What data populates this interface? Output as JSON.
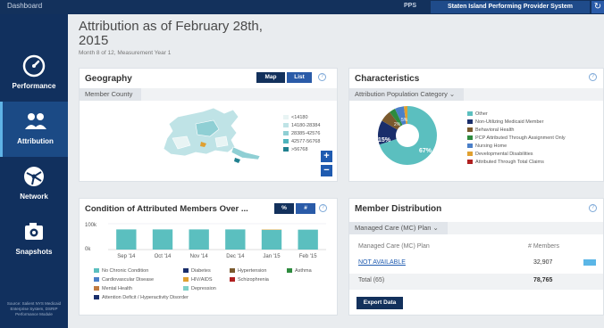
{
  "topbar": {
    "crumb": "Dashboard",
    "pps_label": "PPS",
    "pps_value": "Staten Island Performing Provider System"
  },
  "sidebar": {
    "items": [
      {
        "label": "Performance",
        "icon": "gauge-icon"
      },
      {
        "label": "Attribution",
        "icon": "people-icon"
      },
      {
        "label": "Network",
        "icon": "network-icon"
      },
      {
        "label": "Snapshots",
        "icon": "camera-icon"
      }
    ],
    "source": "Source: Salient NYS Medicaid Enterprise System, DSRIP Performance Module"
  },
  "header": {
    "title": "Attribution as of February 28th, 2015",
    "subtitle": "Month 8 of 12, Measurement Year 1"
  },
  "geography": {
    "title": "Geography",
    "map_btn": "Map",
    "list_btn": "List",
    "tab": "Member County",
    "legend": [
      "<14180",
      "14180-28384",
      "28385-42576",
      "42577-56768",
      ">56768"
    ],
    "legend_colors": [
      "#e8f4f4",
      "#bfe3e6",
      "#8fcfd4",
      "#4fb4bd",
      "#20808f"
    ],
    "zoom_in": "+",
    "zoom_out": "−"
  },
  "characteristics": {
    "title": "Characteristics",
    "tab": "Attribution Population Category",
    "legend": [
      {
        "label": "Other",
        "color": "#5bbfbf"
      },
      {
        "label": "Non-Utilizing Medicaid Member",
        "color": "#1a2e6b"
      },
      {
        "label": "Behavioral Health",
        "color": "#7a5a2e"
      },
      {
        "label": "PCP Attributed Through Assignment Only",
        "color": "#2e8b3e"
      },
      {
        "label": "Nursing Home",
        "color": "#4a7fc8"
      },
      {
        "label": "Developmental Disabilities",
        "color": "#e0a030"
      },
      {
        "label": "Attributed Through Total Claims",
        "color": "#b02020"
      }
    ],
    "pie_labels": [
      "67%",
      "15%",
      "2%",
      "5%"
    ]
  },
  "condition": {
    "title": "Condition of Attributed Members Over ...",
    "btn_a": "%",
    "btn_b": "#",
    "legend": [
      {
        "label": "No Chronic Condition",
        "color": "#5bbfbf"
      },
      {
        "label": "Diabetes",
        "color": "#1a2e6b"
      },
      {
        "label": "Hypertension",
        "color": "#7a5a2e"
      },
      {
        "label": "Asthma",
        "color": "#2e8b3e"
      },
      {
        "label": "Cardiovascular Disease",
        "color": "#4a7fc8"
      },
      {
        "label": "HIV/AIDS",
        "color": "#e0a030"
      },
      {
        "label": "Schizophrenia",
        "color": "#b02020"
      },
      {
        "label": "Mental Health",
        "color": "#c07a40"
      },
      {
        "label": "Depression",
        "color": "#7fd0c8"
      },
      {
        "label": "Attention Deficit / Hyperactivity Disorder",
        "color": "#1a2e6b"
      }
    ]
  },
  "chart_data": {
    "type": "bar",
    "categories": [
      "Sep '14",
      "Oct '14",
      "Nov '14",
      "Dec '14",
      "Jan '15",
      "Feb '15"
    ],
    "ytick_labels": [
      "100k",
      "0k"
    ],
    "ylim": [
      0,
      100000
    ],
    "series": [
      {
        "name": "No Chronic Condition",
        "values": [
          78000,
          78000,
          78000,
          78000,
          76000,
          77000
        ],
        "color": "#5bbfbf"
      },
      {
        "name": "HIV/AIDS",
        "values": [
          0,
          0,
          0,
          0,
          1500,
          0
        ],
        "color": "#e0a030"
      }
    ]
  },
  "member_distribution": {
    "title": "Member Distribution",
    "tab": "Managed Care (MC) Plan",
    "col_plan": "Managed Care (MC) Plan",
    "col_members": "# Members",
    "rows": [
      {
        "plan": "NOT AVAILABLE",
        "members": "32,907"
      }
    ],
    "total_label": "Total (65)",
    "total_value": "78,765",
    "export_btn": "Export Data"
  }
}
